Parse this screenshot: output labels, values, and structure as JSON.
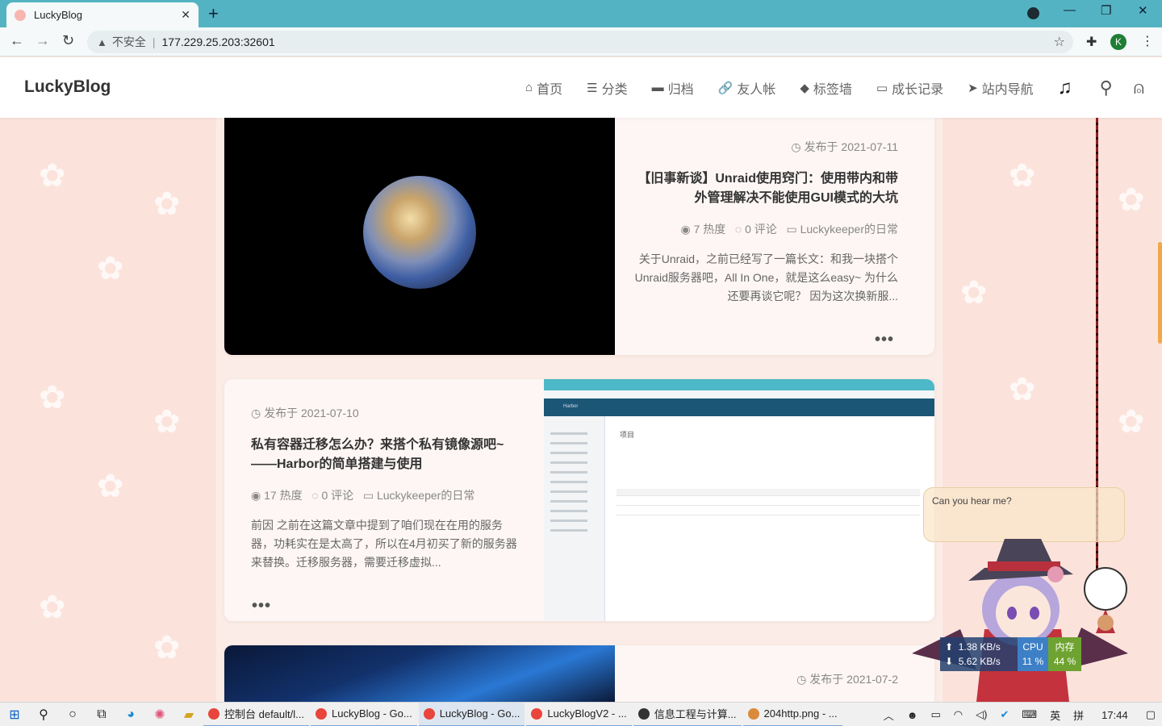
{
  "browser": {
    "tab_title": "LuckyBlog",
    "tab_close": "✕",
    "new_tab": "+",
    "security_label": "不安全",
    "url": "177.229.25.203:32601",
    "profile_initial": "K"
  },
  "site": {
    "logo": "LuckyBlog",
    "nav": [
      {
        "icon": "home-icon",
        "glyph": "⌂",
        "label": "首页"
      },
      {
        "icon": "list-icon",
        "glyph": "☰",
        "label": "分类"
      },
      {
        "icon": "archive-icon",
        "glyph": "▬",
        "label": "归档"
      },
      {
        "icon": "link-icon",
        "glyph": "🔗",
        "label": "友人帐"
      },
      {
        "icon": "tag-icon",
        "glyph": "◆",
        "label": "标签墙"
      },
      {
        "icon": "folder-icon",
        "glyph": "▭",
        "label": "成长记录"
      },
      {
        "icon": "paper-plane-icon",
        "glyph": "➤",
        "label": "站内导航"
      }
    ],
    "music_glyph": "♫",
    "search_glyph": "⚲",
    "user_glyph": "⍝"
  },
  "posts": [
    {
      "date": "发布于 2021-07-11",
      "title": "【旧事新谈】Unraid使用窍门：使用带内和带外管理解决不能使用GUI模式的大坑",
      "views": "7 热度",
      "comments": "0 评论",
      "category": "Luckykeeper的日常",
      "excerpt": "关于Unraid，之前已经写了一篇长文：和我一块搭个Unraid服务器吧，All In One，就是这么easy~ 为什么还要再谈它呢？ 因为这次换新服...",
      "more": "•••"
    },
    {
      "date": "发布于 2021-07-10",
      "title": "私有容器迁移怎么办？来搭个私有镜像源吧~——Harbor的简单搭建与使用",
      "views": "17 热度",
      "comments": "0 评论",
      "category": "Luckykeeper的日常",
      "excerpt": "前因 之前在这篇文章中提到了咱们现在在用的服务器，功耗实在是太高了，所以在4月初买了新的服务器来替换。迁移服务器，需要迁移虚拟...",
      "more": "•••"
    },
    {
      "date": "发布于 2021-07-2"
    }
  ],
  "harbor_preview": {
    "brand": "Harbor",
    "page_title": "项目"
  },
  "widget": {
    "speech": "Can you hear me?",
    "upload": "1.38 KB/s",
    "download": "5.62 KB/s",
    "cpu_label": "CPU",
    "cpu_value": "11 %",
    "mem_label": "内存",
    "mem_value": "44 %"
  },
  "taskbar": {
    "apps": [
      {
        "label": "控制台 default/l...",
        "color": "#e8453c"
      },
      {
        "label": "LuckyBlog - Go...",
        "color": "#e8453c"
      },
      {
        "label": "LuckyBlog - Go...",
        "color": "#e8453c"
      },
      {
        "label": "LuckyBlogV2 - ...",
        "color": "#e8453c"
      },
      {
        "label": "信息工程与计算...",
        "color": "#333333"
      },
      {
        "label": "204http.png - ...",
        "color": "#d98a3a"
      }
    ],
    "ime_lang": "英",
    "ime_mode": "拼",
    "time": "17:44"
  }
}
